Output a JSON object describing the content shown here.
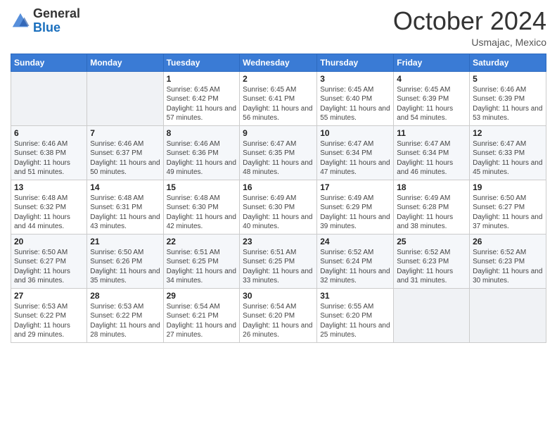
{
  "header": {
    "logo_line1": "General",
    "logo_line2": "Blue",
    "month": "October 2024",
    "location": "Usmajac, Mexico"
  },
  "days_of_week": [
    "Sunday",
    "Monday",
    "Tuesday",
    "Wednesday",
    "Thursday",
    "Friday",
    "Saturday"
  ],
  "weeks": [
    [
      {
        "day": "",
        "sunrise": "",
        "sunset": "",
        "daylight": ""
      },
      {
        "day": "",
        "sunrise": "",
        "sunset": "",
        "daylight": ""
      },
      {
        "day": "1",
        "sunrise": "Sunrise: 6:45 AM",
        "sunset": "Sunset: 6:42 PM",
        "daylight": "Daylight: 11 hours and 57 minutes."
      },
      {
        "day": "2",
        "sunrise": "Sunrise: 6:45 AM",
        "sunset": "Sunset: 6:41 PM",
        "daylight": "Daylight: 11 hours and 56 minutes."
      },
      {
        "day": "3",
        "sunrise": "Sunrise: 6:45 AM",
        "sunset": "Sunset: 6:40 PM",
        "daylight": "Daylight: 11 hours and 55 minutes."
      },
      {
        "day": "4",
        "sunrise": "Sunrise: 6:45 AM",
        "sunset": "Sunset: 6:39 PM",
        "daylight": "Daylight: 11 hours and 54 minutes."
      },
      {
        "day": "5",
        "sunrise": "Sunrise: 6:46 AM",
        "sunset": "Sunset: 6:39 PM",
        "daylight": "Daylight: 11 hours and 53 minutes."
      }
    ],
    [
      {
        "day": "6",
        "sunrise": "Sunrise: 6:46 AM",
        "sunset": "Sunset: 6:38 PM",
        "daylight": "Daylight: 11 hours and 51 minutes."
      },
      {
        "day": "7",
        "sunrise": "Sunrise: 6:46 AM",
        "sunset": "Sunset: 6:37 PM",
        "daylight": "Daylight: 11 hours and 50 minutes."
      },
      {
        "day": "8",
        "sunrise": "Sunrise: 6:46 AM",
        "sunset": "Sunset: 6:36 PM",
        "daylight": "Daylight: 11 hours and 49 minutes."
      },
      {
        "day": "9",
        "sunrise": "Sunrise: 6:47 AM",
        "sunset": "Sunset: 6:35 PM",
        "daylight": "Daylight: 11 hours and 48 minutes."
      },
      {
        "day": "10",
        "sunrise": "Sunrise: 6:47 AM",
        "sunset": "Sunset: 6:34 PM",
        "daylight": "Daylight: 11 hours and 47 minutes."
      },
      {
        "day": "11",
        "sunrise": "Sunrise: 6:47 AM",
        "sunset": "Sunset: 6:34 PM",
        "daylight": "Daylight: 11 hours and 46 minutes."
      },
      {
        "day": "12",
        "sunrise": "Sunrise: 6:47 AM",
        "sunset": "Sunset: 6:33 PM",
        "daylight": "Daylight: 11 hours and 45 minutes."
      }
    ],
    [
      {
        "day": "13",
        "sunrise": "Sunrise: 6:48 AM",
        "sunset": "Sunset: 6:32 PM",
        "daylight": "Daylight: 11 hours and 44 minutes."
      },
      {
        "day": "14",
        "sunrise": "Sunrise: 6:48 AM",
        "sunset": "Sunset: 6:31 PM",
        "daylight": "Daylight: 11 hours and 43 minutes."
      },
      {
        "day": "15",
        "sunrise": "Sunrise: 6:48 AM",
        "sunset": "Sunset: 6:30 PM",
        "daylight": "Daylight: 11 hours and 42 minutes."
      },
      {
        "day": "16",
        "sunrise": "Sunrise: 6:49 AM",
        "sunset": "Sunset: 6:30 PM",
        "daylight": "Daylight: 11 hours and 40 minutes."
      },
      {
        "day": "17",
        "sunrise": "Sunrise: 6:49 AM",
        "sunset": "Sunset: 6:29 PM",
        "daylight": "Daylight: 11 hours and 39 minutes."
      },
      {
        "day": "18",
        "sunrise": "Sunrise: 6:49 AM",
        "sunset": "Sunset: 6:28 PM",
        "daylight": "Daylight: 11 hours and 38 minutes."
      },
      {
        "day": "19",
        "sunrise": "Sunrise: 6:50 AM",
        "sunset": "Sunset: 6:27 PM",
        "daylight": "Daylight: 11 hours and 37 minutes."
      }
    ],
    [
      {
        "day": "20",
        "sunrise": "Sunrise: 6:50 AM",
        "sunset": "Sunset: 6:27 PM",
        "daylight": "Daylight: 11 hours and 36 minutes."
      },
      {
        "day": "21",
        "sunrise": "Sunrise: 6:50 AM",
        "sunset": "Sunset: 6:26 PM",
        "daylight": "Daylight: 11 hours and 35 minutes."
      },
      {
        "day": "22",
        "sunrise": "Sunrise: 6:51 AM",
        "sunset": "Sunset: 6:25 PM",
        "daylight": "Daylight: 11 hours and 34 minutes."
      },
      {
        "day": "23",
        "sunrise": "Sunrise: 6:51 AM",
        "sunset": "Sunset: 6:25 PM",
        "daylight": "Daylight: 11 hours and 33 minutes."
      },
      {
        "day": "24",
        "sunrise": "Sunrise: 6:52 AM",
        "sunset": "Sunset: 6:24 PM",
        "daylight": "Daylight: 11 hours and 32 minutes."
      },
      {
        "day": "25",
        "sunrise": "Sunrise: 6:52 AM",
        "sunset": "Sunset: 6:23 PM",
        "daylight": "Daylight: 11 hours and 31 minutes."
      },
      {
        "day": "26",
        "sunrise": "Sunrise: 6:52 AM",
        "sunset": "Sunset: 6:23 PM",
        "daylight": "Daylight: 11 hours and 30 minutes."
      }
    ],
    [
      {
        "day": "27",
        "sunrise": "Sunrise: 6:53 AM",
        "sunset": "Sunset: 6:22 PM",
        "daylight": "Daylight: 11 hours and 29 minutes."
      },
      {
        "day": "28",
        "sunrise": "Sunrise: 6:53 AM",
        "sunset": "Sunset: 6:22 PM",
        "daylight": "Daylight: 11 hours and 28 minutes."
      },
      {
        "day": "29",
        "sunrise": "Sunrise: 6:54 AM",
        "sunset": "Sunset: 6:21 PM",
        "daylight": "Daylight: 11 hours and 27 minutes."
      },
      {
        "day": "30",
        "sunrise": "Sunrise: 6:54 AM",
        "sunset": "Sunset: 6:20 PM",
        "daylight": "Daylight: 11 hours and 26 minutes."
      },
      {
        "day": "31",
        "sunrise": "Sunrise: 6:55 AM",
        "sunset": "Sunset: 6:20 PM",
        "daylight": "Daylight: 11 hours and 25 minutes."
      },
      {
        "day": "",
        "sunrise": "",
        "sunset": "",
        "daylight": ""
      },
      {
        "day": "",
        "sunrise": "",
        "sunset": "",
        "daylight": ""
      }
    ]
  ]
}
